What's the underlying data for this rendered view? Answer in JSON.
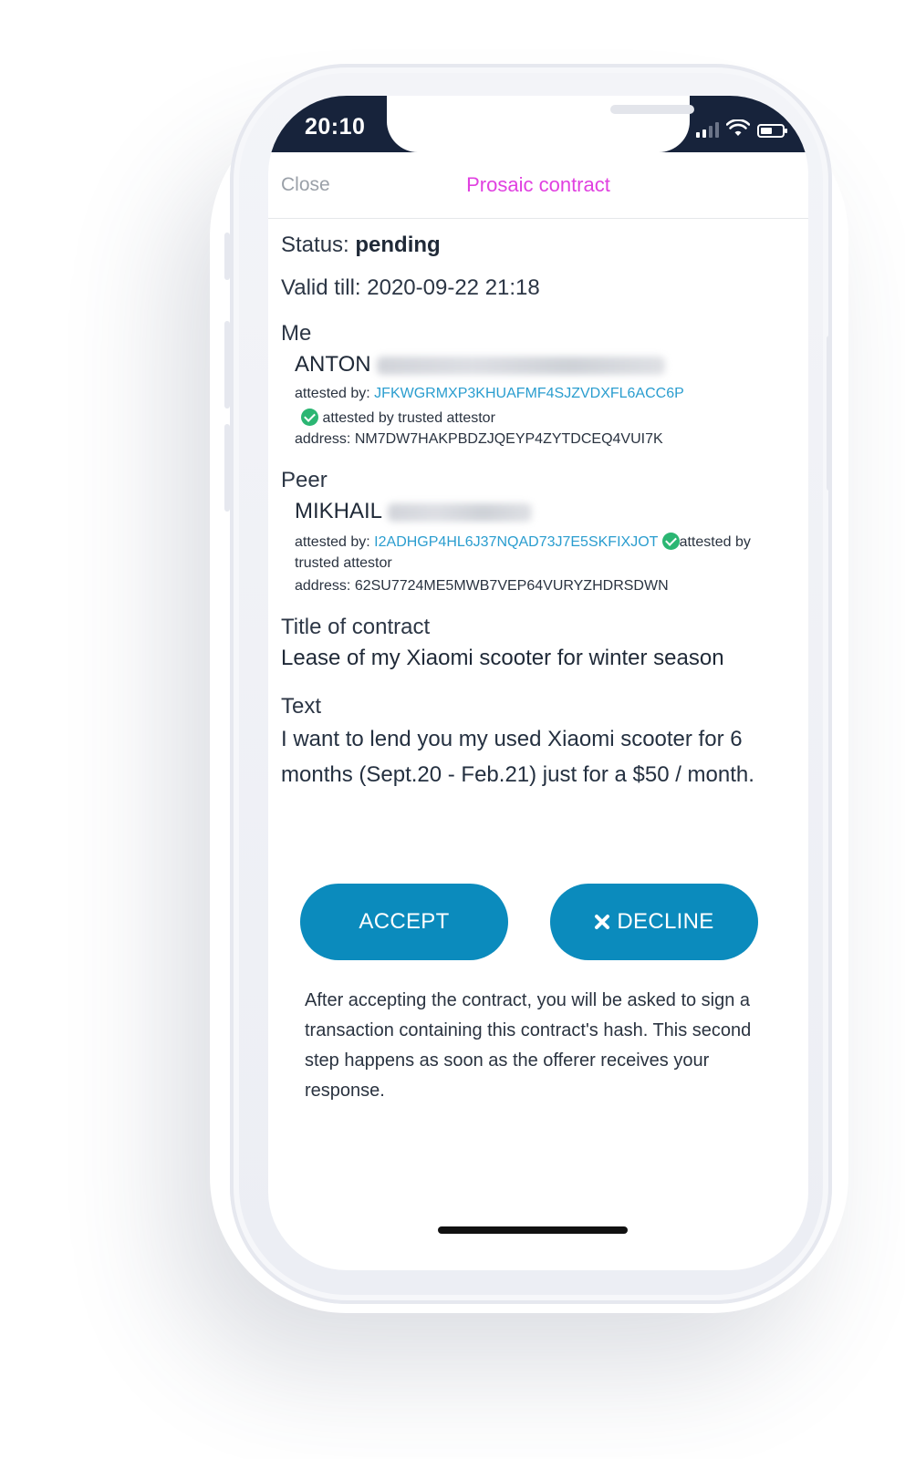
{
  "statusbar": {
    "time": "20:10",
    "signal_icon": "signal-icon",
    "wifi_icon": "wifi-icon",
    "battery_icon": "battery-icon"
  },
  "nav": {
    "close_label": "Close",
    "title": "Prosaic contract",
    "title_color": "#e040e0"
  },
  "contract": {
    "status_label": "Status:",
    "status_value": "pending",
    "valid_till": "Valid till: 2020-09-22 21:18",
    "me": {
      "heading": "Me",
      "name": "ANTON",
      "attested_by_label": "attested by:",
      "attestor": "JFKWGRMXP3KHUAFMF4SJZVDXFL6ACC6P",
      "trusted_label": "attested by trusted attestor",
      "address": "address: NM7DW7HAKPBDZJQEYP4ZYTDCEQ4VUI7K"
    },
    "peer": {
      "heading": "Peer",
      "name": "MIKHAIL",
      "attested_by_label": "attested by:",
      "attestor": "I2ADHGP4HL6J37NQAD73J7E5SKFIXJOT",
      "trusted_label_a": "attested by",
      "trusted_label_b": "trusted attestor",
      "address": "address: 62SU7724ME5MWB7VEP64VURYZHDRSDWN"
    },
    "title_heading": "Title of contract",
    "title_value": "Lease of my Xiaomi scooter for winter season",
    "text_heading": "Text",
    "text_value": "I want to lend you my used Xiaomi scooter for 6 months (Sept.20 - Feb.21) just for a $50 / month."
  },
  "actions": {
    "accept_label": "ACCEPT",
    "decline_label": "DECLINE",
    "decline_icon": "close-icon",
    "button_color": "#0b8bbd"
  },
  "note": "After accepting the contract, you will be asked to sign a transaction containing this contract's hash. This second step happens as soon as the offerer receives your response."
}
